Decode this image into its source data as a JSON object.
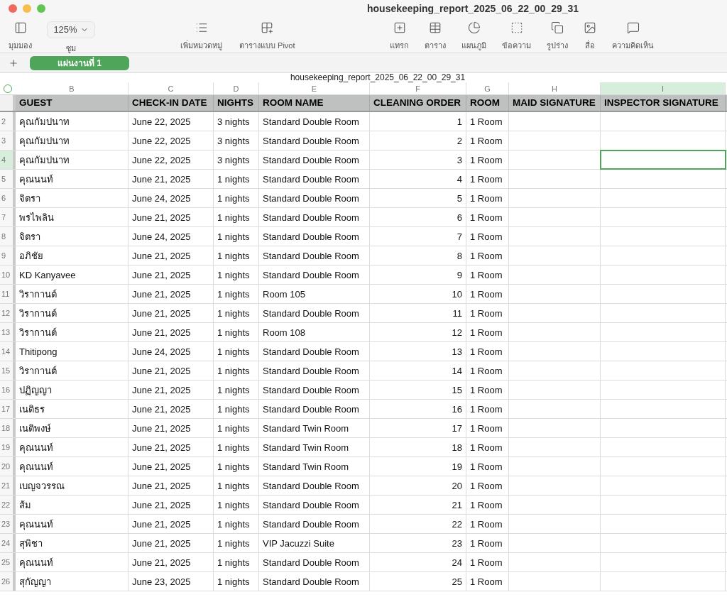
{
  "window": {
    "title": "housekeeping_report_2025_06_22_00_29_31"
  },
  "toolbar": {
    "left": [
      {
        "kind": "view",
        "label": "มุมมอง"
      },
      {
        "kind": "zoom",
        "label": "ซูม",
        "value": "125%"
      }
    ],
    "middle": [
      {
        "kind": "category",
        "label": "เพิ่มหมวดหมู่"
      },
      {
        "kind": "pivot",
        "label": "ตารางแบบ Pivot"
      }
    ],
    "right": [
      {
        "kind": "insert",
        "label": "แทรก"
      },
      {
        "kind": "table",
        "label": "ตาราง"
      },
      {
        "kind": "chart",
        "label": "แผนภูมิ"
      },
      {
        "kind": "text",
        "label": "ข้อความ"
      },
      {
        "kind": "shape",
        "label": "รูปร่าง"
      },
      {
        "kind": "media",
        "label": "สื่อ"
      },
      {
        "kind": "comment",
        "label": "ความคิดเห็น"
      }
    ]
  },
  "sheet_tabs": [
    {
      "label": "แผ่นงานที่ 1",
      "selected": true
    }
  ],
  "table": {
    "title": "housekeeping_report_2025_06_22_00_29_31",
    "columns": [
      {
        "letter": "B",
        "header": "GUEST",
        "selected": false
      },
      {
        "letter": "C",
        "header": "CHECK-IN DATE",
        "selected": false
      },
      {
        "letter": "D",
        "header": "NIGHTS",
        "selected": false
      },
      {
        "letter": "E",
        "header": "ROOM NAME",
        "selected": false
      },
      {
        "letter": "F",
        "header": "CLEANING ORDER",
        "selected": false
      },
      {
        "letter": "G",
        "header": "ROOM",
        "selected": false
      },
      {
        "letter": "H",
        "header": "MAID SIGNATURE",
        "selected": false
      },
      {
        "letter": "I",
        "header": "INSPECTOR SIGNATURE",
        "selected": true
      }
    ],
    "rows": [
      {
        "number": "2",
        "selected": false,
        "cells": [
          "คุณกัมปนาท",
          "June 22, 2025",
          "3 nights",
          "Standard Double Room",
          "1",
          "1 Room"
        ]
      },
      {
        "number": "3",
        "selected": false,
        "cells": [
          "คุณกัมปนาท",
          "June 22, 2025",
          "3 nights",
          "Standard Double Room",
          "2",
          "1 Room"
        ]
      },
      {
        "number": "4",
        "selected": true,
        "cells": [
          "คุณกัมปนาท",
          "June 22, 2025",
          "3 nights",
          "Standard Double Room",
          "3",
          "1 Room"
        ]
      },
      {
        "number": "5",
        "selected": false,
        "cells": [
          "คุณนนท์",
          "June 21, 2025",
          "1 nights",
          "Standard Double Room",
          "4",
          "1 Room"
        ]
      },
      {
        "number": "6",
        "selected": false,
        "cells": [
          "จิตรา",
          "June 24, 2025",
          "1 nights",
          "Standard Double Room",
          "5",
          "1 Room"
        ]
      },
      {
        "number": "7",
        "selected": false,
        "cells": [
          "พรไพลิน",
          "June 21, 2025",
          "1 nights",
          "Standard Double Room",
          "6",
          "1 Room"
        ]
      },
      {
        "number": "8",
        "selected": false,
        "cells": [
          "จิตรา",
          "June 24, 2025",
          "1 nights",
          "Standard Double Room",
          "7",
          "1 Room"
        ]
      },
      {
        "number": "9",
        "selected": false,
        "cells": [
          "อภิชัย",
          "June 21, 2025",
          "1 nights",
          "Standard Double Room",
          "8",
          "1 Room"
        ]
      },
      {
        "number": "10",
        "selected": false,
        "cells": [
          "KD Kanyavee",
          "June 21, 2025",
          "1 nights",
          "Standard Double Room",
          "9",
          "1 Room"
        ]
      },
      {
        "number": "11",
        "selected": false,
        "cells": [
          "วิรากานต์",
          "June 21, 2025",
          "1 nights",
          "Room 105",
          "10",
          "1 Room"
        ]
      },
      {
        "number": "12",
        "selected": false,
        "cells": [
          "วิรากานต์",
          "June 21, 2025",
          "1 nights",
          "Standard Double Room",
          "11",
          "1 Room"
        ]
      },
      {
        "number": "13",
        "selected": false,
        "cells": [
          "วิรากานต์",
          "June 21, 2025",
          "1 nights",
          "Room 108",
          "12",
          "1 Room"
        ]
      },
      {
        "number": "14",
        "selected": false,
        "cells": [
          "Thitipong",
          "June 24, 2025",
          "1 nights",
          "Standard Double Room",
          "13",
          "1 Room"
        ]
      },
      {
        "number": "15",
        "selected": false,
        "cells": [
          "วิรากานต์",
          "June 21, 2025",
          "1 nights",
          "Standard Double Room",
          "14",
          "1 Room"
        ]
      },
      {
        "number": "16",
        "selected": false,
        "cells": [
          "ปฏิญญา",
          "June 21, 2025",
          "1 nights",
          "Standard Double Room",
          "15",
          "1 Room"
        ]
      },
      {
        "number": "17",
        "selected": false,
        "cells": [
          "เนติธร",
          "June 21, 2025",
          "1 nights",
          "Standard Double Room",
          "16",
          "1 Room"
        ]
      },
      {
        "number": "18",
        "selected": false,
        "cells": [
          "เนติพงษ์",
          "June 21, 2025",
          "1 nights",
          "Standard Twin Room",
          "17",
          "1 Room"
        ]
      },
      {
        "number": "19",
        "selected": false,
        "cells": [
          "คุณนนท์",
          "June 21, 2025",
          "1 nights",
          "Standard Twin Room",
          "18",
          "1 Room"
        ]
      },
      {
        "number": "20",
        "selected": false,
        "cells": [
          "คุณนนท์",
          "June 21, 2025",
          "1 nights",
          "Standard Twin Room",
          "19",
          "1 Room"
        ]
      },
      {
        "number": "21",
        "selected": false,
        "cells": [
          "เบญจวรรณ",
          "June 21, 2025",
          "1 nights",
          "Standard Double Room",
          "20",
          "1 Room"
        ]
      },
      {
        "number": "22",
        "selected": false,
        "cells": [
          "ส้ม",
          "June 21, 2025",
          "1 nights",
          "Standard Double Room",
          "21",
          "1 Room"
        ]
      },
      {
        "number": "23",
        "selected": false,
        "cells": [
          "คุณนนท์",
          "June 21, 2025",
          "1 nights",
          "Standard Double Room",
          "22",
          "1 Room"
        ]
      },
      {
        "number": "24",
        "selected": false,
        "cells": [
          "สุพิชา",
          "June 21, 2025",
          "1 nights",
          "VIP Jacuzzi Suite",
          "23",
          "1 Room"
        ]
      },
      {
        "number": "25",
        "selected": false,
        "cells": [
          "คุณนนท์",
          "June 21, 2025",
          "1 nights",
          "Standard Double Room",
          "24",
          "1 Room"
        ]
      },
      {
        "number": "26",
        "selected": false,
        "cells": [
          "สุกัญญา",
          "June 23, 2025",
          "1 nights",
          "Standard Double Room",
          "25",
          "1 Room"
        ]
      }
    ]
  }
}
